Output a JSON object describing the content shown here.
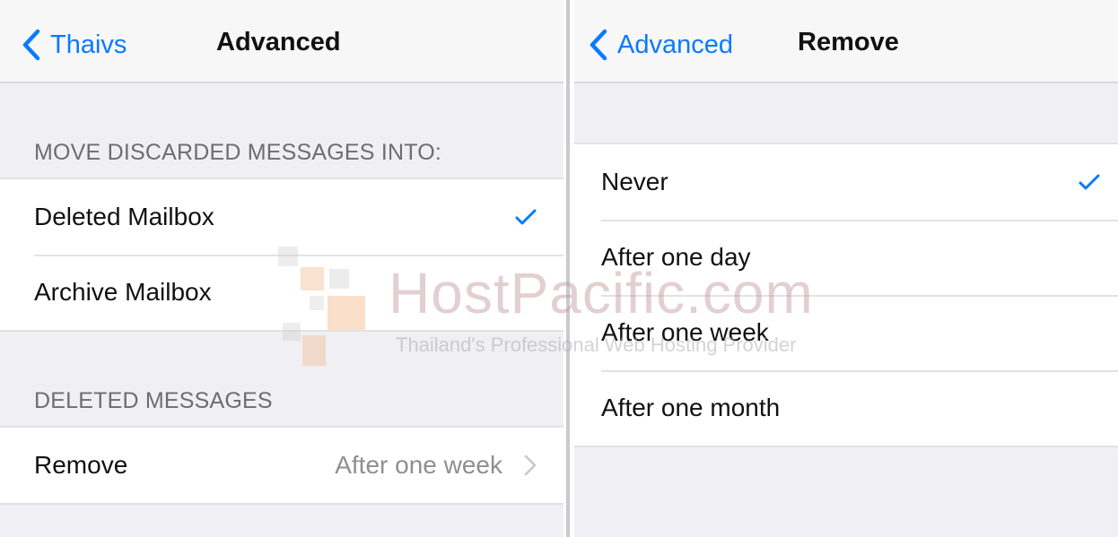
{
  "left_screen": {
    "back_label": "Thaivs",
    "title": "Advanced",
    "section1_header": "MOVE DISCARDED MESSAGES INTO:",
    "mailbox_options": [
      {
        "label": "Deleted Mailbox",
        "selected": true
      },
      {
        "label": "Archive Mailbox",
        "selected": false
      }
    ],
    "section2_header": "DELETED MESSAGES",
    "remove_row": {
      "label": "Remove",
      "value": "After one week"
    }
  },
  "right_screen": {
    "back_label": "Advanced",
    "title": "Remove",
    "options": [
      {
        "label": "Never",
        "selected": true
      },
      {
        "label": "After one day",
        "selected": false
      },
      {
        "label": "After one week",
        "selected": false
      },
      {
        "label": "After one month",
        "selected": false
      }
    ]
  },
  "watermark": {
    "brand": "HostPacific.com",
    "tagline": "Thailand's Professional Web Hosting Provider"
  },
  "colors": {
    "accent": "#0a7aff",
    "background": "#efeff4",
    "secondary_text": "#8e8e93",
    "separator": "#e2e2e6"
  },
  "icons": {
    "back": "chevron-left-icon",
    "selected": "checkmark-icon",
    "disclosure": "chevron-right-icon"
  }
}
